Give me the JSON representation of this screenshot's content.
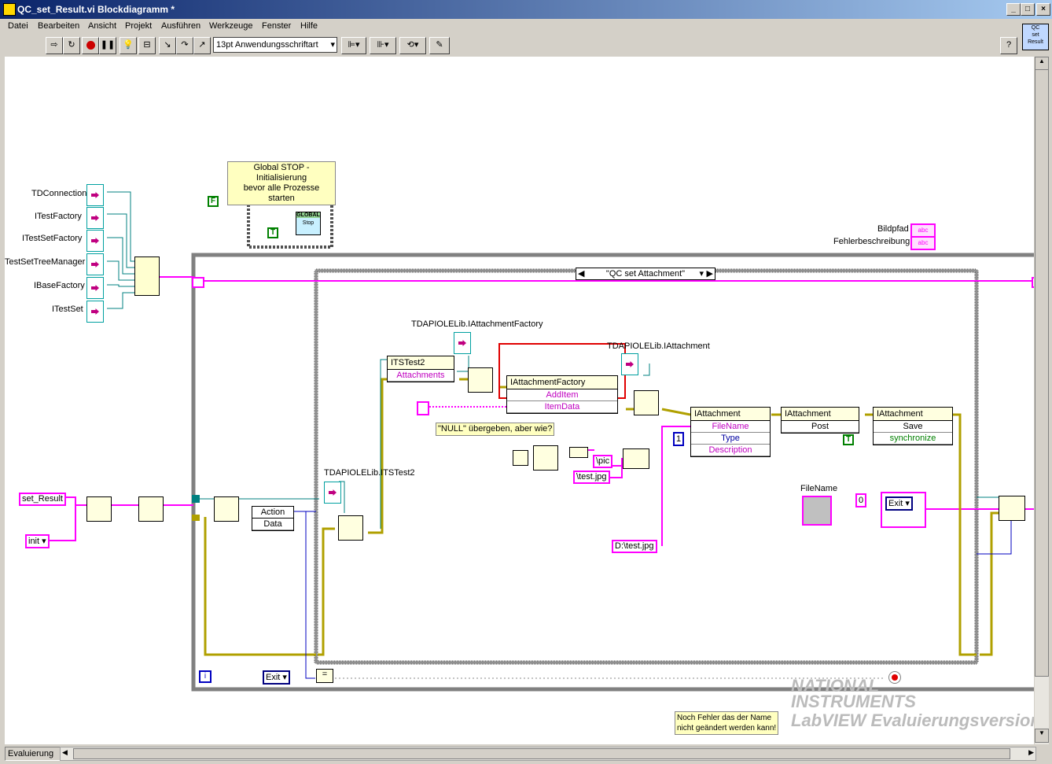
{
  "window": {
    "title": "QC_set_Result.vi Blockdiagramm *"
  },
  "menu": [
    "Datei",
    "Bearbeiten",
    "Ansicht",
    "Projekt",
    "Ausführen",
    "Werkzeuge",
    "Fenster",
    "Hilfe"
  ],
  "toolbar": {
    "font_select": "13pt Anwendungsschriftart",
    "help": "?"
  },
  "vi_icon": {
    "line1": "QC",
    "line2": "set",
    "line3": "Result"
  },
  "diagram": {
    "comment_global": "Global STOP - Initialisierung\nbevor alle Prozesse starten",
    "global_label": "GLOBAL",
    "global_var": "Stop",
    "bool_f": "F",
    "bool_t": "T",
    "bool_t2": "T",
    "refs": [
      "TDConnection",
      "ITestFactory",
      "ITestSetFactory",
      "TestSetTreeManager",
      "IBaseFactory",
      "ITestSet"
    ],
    "bildpfad": "Bildpfad",
    "fehlerbeschreibung": "Fehlerbeschreibung",
    "abc": "abc",
    "case_selector": "\"QC set Attachment\"",
    "ref_iattachmentfactory": "TDAPIOLELib.IAttachmentFactory",
    "ref_iattachment": "TDAPIOLELib.IAttachment",
    "ref_itstest2": "TDAPIOLELib.ITSTest2",
    "itstest2_node": {
      "title": "ITSTest2",
      "prop": "Attachments"
    },
    "factory_node": {
      "title": "IAttachmentFactory",
      "rows": [
        "AddItem",
        "ItemData"
      ]
    },
    "null_comment": "\"NULL\" übergeben, aber wie?",
    "iatt_prop": {
      "title": "IAttachment",
      "rows": [
        "FileName",
        "Type",
        "Description"
      ]
    },
    "iatt_post": {
      "title": "IAttachment",
      "method": "Post"
    },
    "iatt_save": {
      "title": "IAttachment",
      "method": "Save",
      "param": "synchronize"
    },
    "const_one": "1",
    "const_zero": "0",
    "str_pic": "\\pic",
    "str_testjpg": "\\test.jpg",
    "str_dpath": "D:\\test.jpg",
    "filename_label": "FileName",
    "exit_enum": "Exit",
    "set_result": "set_Result",
    "init_enum": "init",
    "action": "Action",
    "data": "Data",
    "exit_enum2": "Exit",
    "loop_iter": "i",
    "comment_bottom": "Noch Fehler das der Name\nnicht geändert werden kann!"
  },
  "watermark": {
    "line1": "NATIONAL",
    "line2": "INSTRUMENTS",
    "line3": "LabVIEW Evaluierungsversion"
  },
  "status": {
    "label": "Evaluierung"
  },
  "colors": {
    "wire_pink": "#ff00ff",
    "wire_blue": "#0000c0",
    "wire_teal": "#008080",
    "wire_yellow": "#b0a000",
    "frame": "#808080",
    "highlight": "#e00000"
  }
}
